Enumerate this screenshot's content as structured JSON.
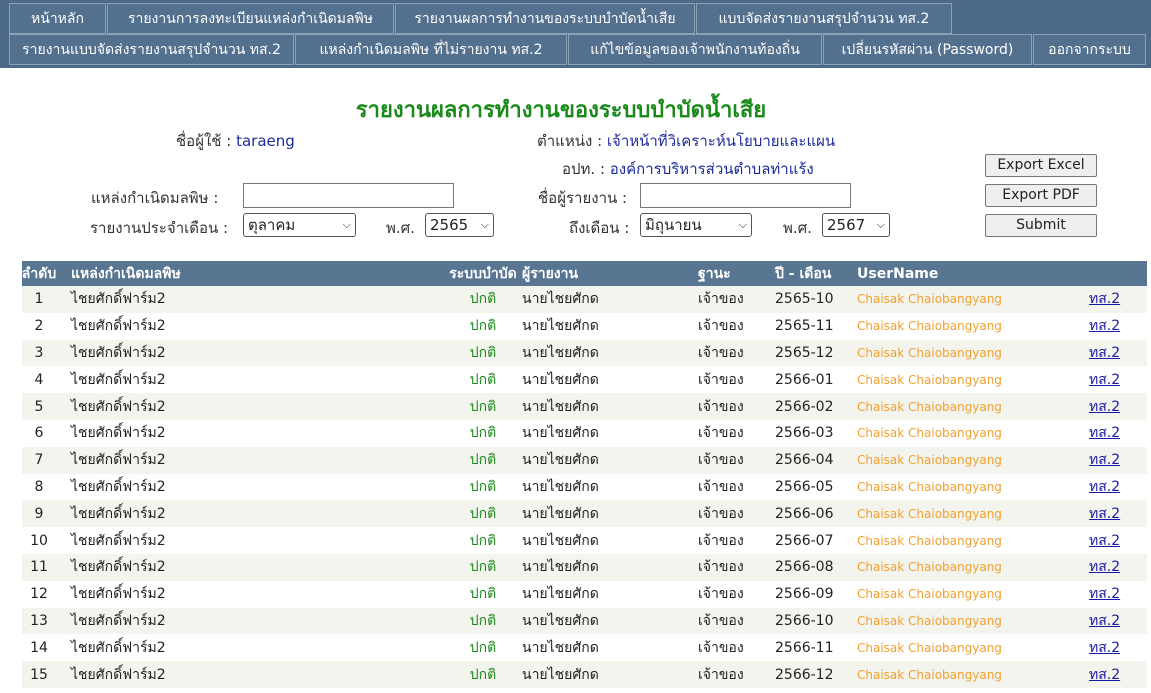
{
  "nav": {
    "row1": [
      "หน้าหลัก",
      "รายงานการลงทะเบียนแหล่งกำเนิดมลพิษ",
      "รายงานผลการทำงานของระบบบำบัดน้ำเสีย",
      "แบบจัดส่งรายงานสรุปจำนวน ทส.2"
    ],
    "row2": [
      "รายงานแบบจัดส่งรายงานสรุปจำนวน ทส.2",
      "แหล่งกำเนิดมลพิษ ที่ไม่รายงาน ทส.2",
      "แก้ไขข้อมูลของเจ้าพนักงานท้องถิ่น",
      "เปลี่ยนรหัสผ่าน (Password)",
      "ออกจากระบบ"
    ]
  },
  "header": {
    "title": "รายงานผลการทำงานของระบบบำบัดน้ำเสีย",
    "user_label": "ชื่อผู้ใช้ :",
    "user_value": "taraeng",
    "position_label": "ตำแหน่ง :",
    "position_value": "เจ้าหน้าที่วิเคราะห์นโยบายและแผน",
    "org_label": "อปท. :",
    "org_value": "องค์การบริหารส่วนตำบลท่าแร้ง"
  },
  "filters": {
    "source_label": "แหล่งกำเนิดมลพิษ :",
    "source_value": "",
    "reporter_label": "ชื่อผู้รายงาน :",
    "reporter_value": "",
    "month_from_label": "รายงานประจำเดือน :",
    "month_from": "ตุลาคม",
    "year_label": "พ.ศ.",
    "year_from": "2565",
    "month_to_label": "ถึงเดือน :",
    "month_to": "มิถุนายน",
    "year_to": "2567"
  },
  "buttons": {
    "export_excel": "Export Excel",
    "export_pdf": "Export PDF",
    "submit": "Submit"
  },
  "table": {
    "headers": [
      "ลำดับ",
      "แหล่งกำเนิดมลพิษ",
      "ระบบบำบัด",
      "ผู้รายงาน",
      "ฐานะ",
      "ปี - เดือน",
      "UserName"
    ],
    "rows": [
      {
        "no": "1",
        "source": "ไชยศักดิ์ฟาร์ม2",
        "system": "ปกติ",
        "reporter": "นายไชยศักด",
        "status": "เจ้าของ",
        "ym": "2565-10",
        "user": "Chaisak Chaiobangyang",
        "link": "ทส.2"
      },
      {
        "no": "2",
        "source": "ไชยศักดิ์ฟาร์ม2",
        "system": "ปกติ",
        "reporter": "นายไชยศักด",
        "status": "เจ้าของ",
        "ym": "2565-11",
        "user": "Chaisak Chaiobangyang",
        "link": "ทส.2"
      },
      {
        "no": "3",
        "source": "ไชยศักดิ์ฟาร์ม2",
        "system": "ปกติ",
        "reporter": "นายไชยศักด",
        "status": "เจ้าของ",
        "ym": "2565-12",
        "user": "Chaisak Chaiobangyang",
        "link": "ทส.2"
      },
      {
        "no": "4",
        "source": "ไชยศักดิ์ฟาร์ม2",
        "system": "ปกติ",
        "reporter": "นายไชยศักด",
        "status": "เจ้าของ",
        "ym": "2566-01",
        "user": "Chaisak Chaiobangyang",
        "link": "ทส.2"
      },
      {
        "no": "5",
        "source": "ไชยศักดิ์ฟาร์ม2",
        "system": "ปกติ",
        "reporter": "นายไชยศักด",
        "status": "เจ้าของ",
        "ym": "2566-02",
        "user": "Chaisak Chaiobangyang",
        "link": "ทส.2"
      },
      {
        "no": "6",
        "source": "ไชยศักดิ์ฟาร์ม2",
        "system": "ปกติ",
        "reporter": "นายไชยศักด",
        "status": "เจ้าของ",
        "ym": "2566-03",
        "user": "Chaisak Chaiobangyang",
        "link": "ทส.2"
      },
      {
        "no": "7",
        "source": "ไชยศักดิ์ฟาร์ม2",
        "system": "ปกติ",
        "reporter": "นายไชยศักด",
        "status": "เจ้าของ",
        "ym": "2566-04",
        "user": "Chaisak Chaiobangyang",
        "link": "ทส.2"
      },
      {
        "no": "8",
        "source": "ไชยศักดิ์ฟาร์ม2",
        "system": "ปกติ",
        "reporter": "นายไชยศักด",
        "status": "เจ้าของ",
        "ym": "2566-05",
        "user": "Chaisak Chaiobangyang",
        "link": "ทส.2"
      },
      {
        "no": "9",
        "source": "ไชยศักดิ์ฟาร์ม2",
        "system": "ปกติ",
        "reporter": "นายไชยศักด",
        "status": "เจ้าของ",
        "ym": "2566-06",
        "user": "Chaisak Chaiobangyang",
        "link": "ทส.2"
      },
      {
        "no": "10",
        "source": "ไชยศักดิ์ฟาร์ม2",
        "system": "ปกติ",
        "reporter": "นายไชยศักด",
        "status": "เจ้าของ",
        "ym": "2566-07",
        "user": "Chaisak Chaiobangyang",
        "link": "ทส.2"
      },
      {
        "no": "11",
        "source": "ไชยศักดิ์ฟาร์ม2",
        "system": "ปกติ",
        "reporter": "นายไชยศักด",
        "status": "เจ้าของ",
        "ym": "2566-08",
        "user": "Chaisak Chaiobangyang",
        "link": "ทส.2"
      },
      {
        "no": "12",
        "source": "ไชยศักดิ์ฟาร์ม2",
        "system": "ปกติ",
        "reporter": "นายไชยศักด",
        "status": "เจ้าของ",
        "ym": "2566-09",
        "user": "Chaisak Chaiobangyang",
        "link": "ทส.2"
      },
      {
        "no": "13",
        "source": "ไชยศักดิ์ฟาร์ม2",
        "system": "ปกติ",
        "reporter": "นายไชยศักด",
        "status": "เจ้าของ",
        "ym": "2566-10",
        "user": "Chaisak Chaiobangyang",
        "link": "ทส.2"
      },
      {
        "no": "14",
        "source": "ไชยศักดิ์ฟาร์ม2",
        "system": "ปกติ",
        "reporter": "นายไชยศักด",
        "status": "เจ้าของ",
        "ym": "2566-11",
        "user": "Chaisak Chaiobangyang",
        "link": "ทส.2"
      },
      {
        "no": "15",
        "source": "ไชยศักดิ์ฟาร์ม2",
        "system": "ปกติ",
        "reporter": "นายไชยศักด",
        "status": "เจ้าของ",
        "ym": "2566-12",
        "user": "Chaisak Chaiobangyang",
        "link": "ทส.2"
      }
    ]
  },
  "colors": {
    "nav_bg": "#4c6a88",
    "title_green": "#1a8a1a",
    "value_blue": "#1d2b9a",
    "table_header": "#587592",
    "username_orange": "#f0a030",
    "link_blue": "#1a1aa8"
  }
}
